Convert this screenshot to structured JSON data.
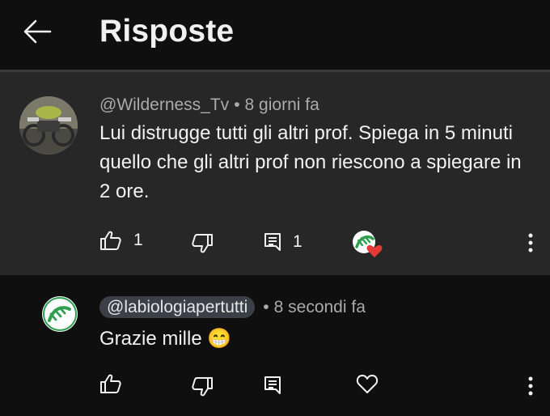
{
  "header": {
    "title": "Risposte"
  },
  "parent_comment": {
    "author": "@Wilderness_Tv",
    "time": "8 giorni fa",
    "text": "Lui distrugge tutti gli altri prof. Spiega in 5 minuti quello che gli altri prof non riescono a spiegare in 2 ore.",
    "likes": "1",
    "replies": "1"
  },
  "reply_comment": {
    "author": "@labiologiapertutti",
    "time": "8 secondi fa",
    "text": "Grazie mille 😁"
  },
  "icons": {
    "back": "back-arrow-icon",
    "like": "thumb-up-icon",
    "dislike": "thumb-down-icon",
    "reply": "reply-comment-icon",
    "heart": "heart-icon",
    "more": "more-vert-icon"
  },
  "colors": {
    "background": "#0f0f0f",
    "highlight": "#272727",
    "heart": "#e53935",
    "brand_green": "#2e9e4f"
  }
}
